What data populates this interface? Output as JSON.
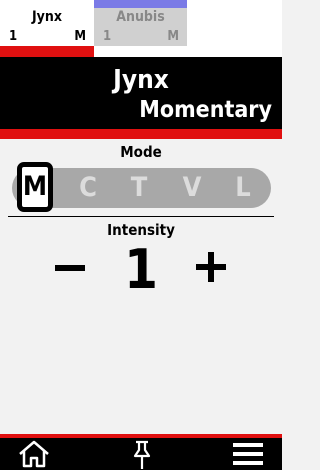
{
  "tabs": [
    {
      "name": "Jynx",
      "number": "1",
      "mode": "M",
      "active": true
    },
    {
      "name": "Anubis",
      "number": "1",
      "mode": "M",
      "active": false
    }
  ],
  "header": {
    "device_name": "Jynx",
    "mode_name": "Momentary"
  },
  "mode_selector": {
    "label": "Mode",
    "options": [
      "M",
      "C",
      "T",
      "V",
      "L"
    ],
    "selected": "M"
  },
  "intensity": {
    "label": "Intensity",
    "value": "1",
    "decrease_icon": "minus-icon",
    "increase_icon": "plus-icon"
  },
  "bottom_nav": {
    "icons": [
      "home-icon",
      "pin-icon",
      "menu-icon"
    ]
  },
  "colors": {
    "accent_red": "#e01010",
    "inactive_tab_accent": "#7a7ae6",
    "header_bg": "#000000"
  }
}
